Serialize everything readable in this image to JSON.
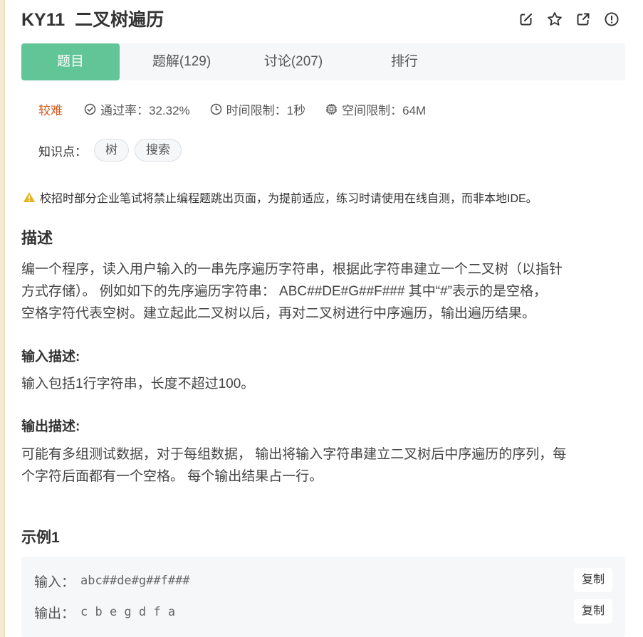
{
  "problem": {
    "code": "KY11",
    "title": "二叉树遍历"
  },
  "header_icons": [
    "edit-icon",
    "star-icon",
    "external-link-icon",
    "report-icon"
  ],
  "tabs": [
    {
      "label": "题目",
      "active": true
    },
    {
      "label": "题解(129)",
      "active": false
    },
    {
      "label": "讨论(207)",
      "active": false
    },
    {
      "label": "排行",
      "active": false
    }
  ],
  "meta": {
    "difficulty": "较难",
    "pass_rate": "通过率：32.32%",
    "time_limit": "时间限制：1秒",
    "space_limit": "空间限制：64M"
  },
  "knowledge": {
    "label": "知识点：",
    "tags": [
      "树",
      "搜索"
    ]
  },
  "warning": "校招时部分企业笔试将禁止编程题跳出页面，为提前适应，练习时请使用在线自测，而非本地IDE。",
  "description": {
    "heading": "描述",
    "lines": [
      "编一个程序，读入用户输入的一串先序遍历字符串，根据此字符串建立一个二叉树（以指针",
      "方式存储）。 例如如下的先序遍历字符串： ABC##DE#G##F### 其中“#”表示的是空格，",
      "空格字符代表空树。建立起此二叉树以后，再对二叉树进行中序遍历，输出遍历结果。"
    ]
  },
  "input_desc": {
    "heading": "输入描述:",
    "text": "输入包括1行字符串，长度不超过100。"
  },
  "output_desc": {
    "heading": "输出描述:",
    "lines": [
      "可能有多组测试数据，对于每组数据， 输出将输入字符串建立二叉树后中序遍历的序列，每",
      "个字符后面都有一个空格。 每个输出结果占一行。"
    ]
  },
  "example": {
    "heading": "示例1",
    "input_label": "输入：",
    "input_value": "abc##de#g##f###",
    "output_label": "输出：",
    "output_value": "c b e g d f a",
    "copy_label": "复制"
  },
  "colors": {
    "accent": "#62c597",
    "difficulty": "#d35a1e",
    "warning": "#e6b422"
  }
}
